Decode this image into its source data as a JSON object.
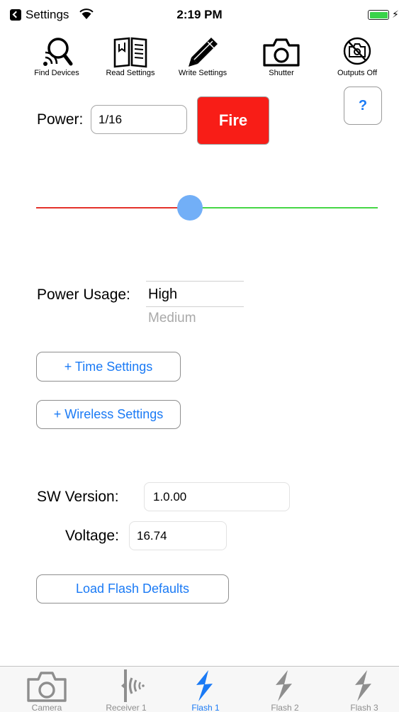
{
  "status_bar": {
    "back_app": "Settings",
    "time": "2:19 PM",
    "icons": [
      "back-arrow-icon",
      "wifi-icon",
      "battery-icon",
      "charging-bolt-icon"
    ]
  },
  "toolbar": [
    {
      "label": "Find Devices",
      "icon": "search-icon"
    },
    {
      "label": "Read Settings",
      "icon": "book-icon"
    },
    {
      "label": "Write Settings",
      "icon": "pencil-icon"
    },
    {
      "label": "Shutter",
      "icon": "camera-icon"
    },
    {
      "label": "Outputs Off",
      "icon": "camera-off-icon"
    }
  ],
  "help_button": {
    "label": "?"
  },
  "power": {
    "label": "Power:",
    "value": "1/16"
  },
  "fire_button": {
    "label": "Fire",
    "color": "#f81d17"
  },
  "power_slider": {
    "position_fraction": 0.45,
    "min_track_color": "#e4322b",
    "max_track_color": "#46d646",
    "thumb_color": "#72aff7"
  },
  "power_usage": {
    "label": "Power Usage:",
    "selected": "High",
    "next_option": "Medium"
  },
  "buttons": {
    "time_settings": "+ Time Settings",
    "wireless_settings": "+ Wireless Settings",
    "load_flash_defaults": "Load Flash Defaults"
  },
  "sw_version": {
    "label": "SW Version:",
    "value": "1.0.00"
  },
  "voltage": {
    "label": "Voltage:",
    "value": "16.74"
  },
  "tab_bar": {
    "active_color": "#1a7af5",
    "inactive_color": "#8e8e8e",
    "tabs": [
      {
        "label": "Camera",
        "icon": "camera-icon",
        "active": false
      },
      {
        "label": "Receiver 1",
        "icon": "receiver-icon",
        "active": false
      },
      {
        "label": "Flash 1",
        "icon": "lightning-icon",
        "active": true
      },
      {
        "label": "Flash 2",
        "icon": "lightning-icon",
        "active": false
      },
      {
        "label": "Flash 3",
        "icon": "lightning-icon",
        "active": false
      }
    ]
  }
}
